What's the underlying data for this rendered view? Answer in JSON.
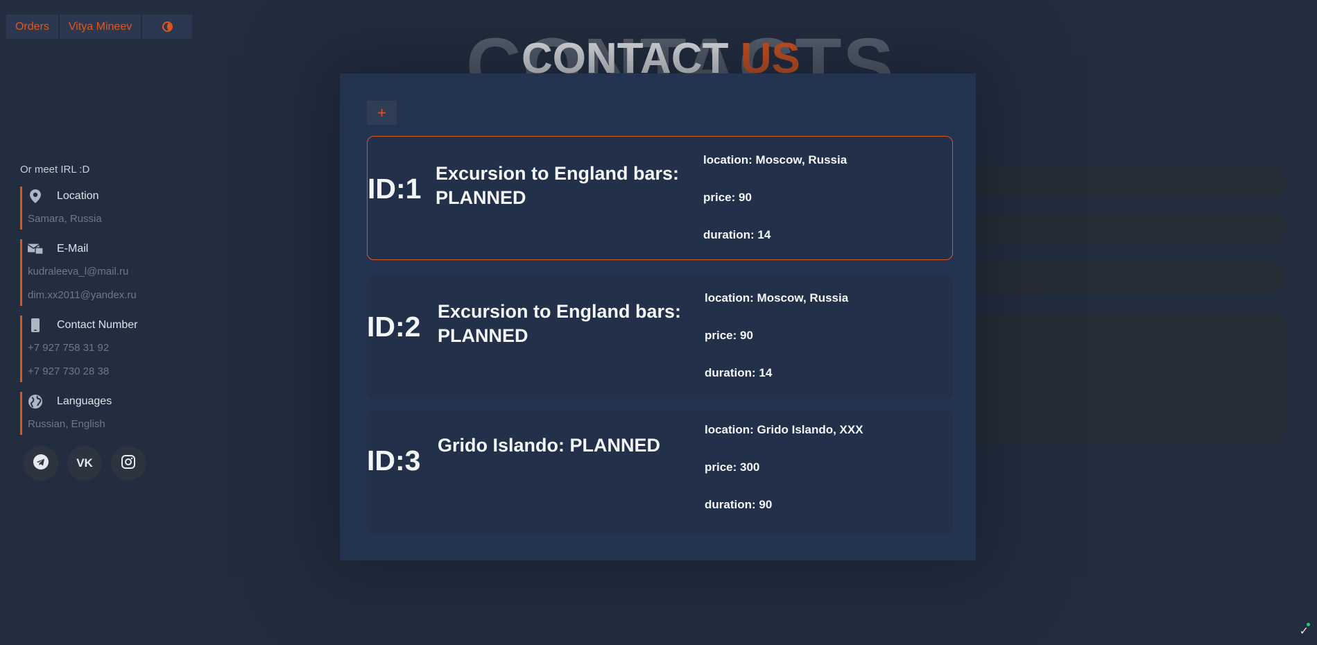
{
  "nav": {
    "orders_label": "Orders",
    "user_label": "Vitya Mineev",
    "theme_icon": "theme-toggle-icon"
  },
  "heading": {
    "background_text": "CONTACTS",
    "title_main": "CONTACT",
    "title_accent": "US"
  },
  "sidebar": {
    "intro": "Or meet IRL :D",
    "location": {
      "icon": "location-pin-icon",
      "label": "Location",
      "values": [
        "Samara, Russia"
      ]
    },
    "email": {
      "icon": "mail-icon",
      "label": "E-Mail",
      "values": [
        "kudraleeva_l@mail.ru",
        "dim.xx2011@yandex.ru"
      ]
    },
    "phone": {
      "icon": "phone-icon",
      "label": "Contact Number",
      "values": [
        "+7 927 758 31 92",
        "+7 927 730 28 38"
      ]
    },
    "languages": {
      "icon": "globe-icon",
      "label": "Languages",
      "values": [
        "Russian, English"
      ]
    },
    "socials": [
      {
        "name": "telegram-icon",
        "glyph": "➤"
      },
      {
        "name": "vk-icon",
        "glyph": "VK"
      },
      {
        "name": "instagram-icon",
        "glyph": "◎"
      }
    ]
  },
  "modal": {
    "add_label": "+",
    "orders": [
      {
        "id": "ID:1",
        "title": "Excursion to England bars: PLANNED",
        "location": "location: Moscow, Russia",
        "price": "price: 90",
        "duration": "duration: 14"
      },
      {
        "id": "ID:2",
        "title": "Excursion to England bars: PLANNED",
        "location": "location: Moscow, Russia",
        "price": "price: 90",
        "duration": "duration: 14"
      },
      {
        "id": "ID:3",
        "title": "Grido Islando: PLANNED",
        "location": "location: Grido Islando, XXX",
        "price": "price: 300",
        "duration": "duration: 90"
      }
    ]
  },
  "colors": {
    "accent": "#e0571c",
    "background": "#222d3f",
    "modal": "#243350"
  }
}
